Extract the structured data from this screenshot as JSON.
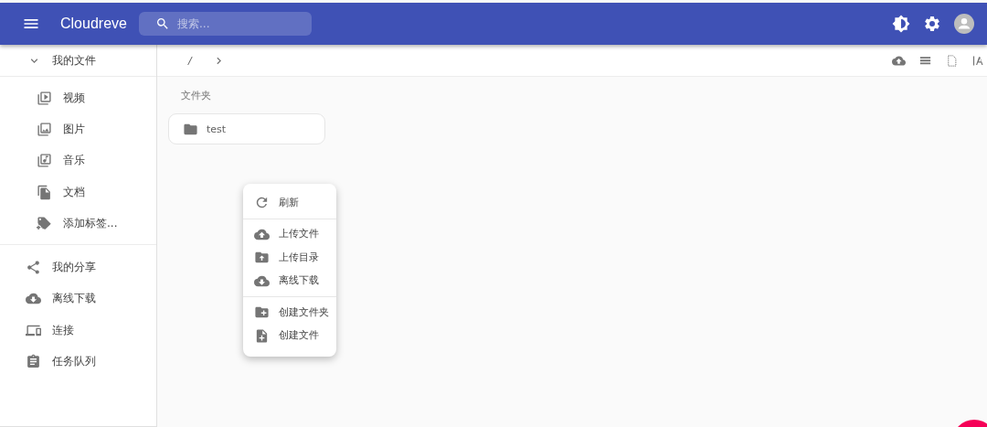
{
  "app_bar": {
    "title": "Cloudreve",
    "search": {
      "placeholder": "搜索..."
    }
  },
  "sidebar": {
    "group": {
      "label": "我的文件",
      "expanded": true,
      "children": [
        {
          "label": "视频"
        },
        {
          "label": "图片"
        },
        {
          "label": "音乐"
        },
        {
          "label": "文档"
        },
        {
          "label": "添加标签..."
        }
      ]
    },
    "items": [
      {
        "label": "我的分享"
      },
      {
        "label": "离线下载"
      },
      {
        "label": "连接"
      },
      {
        "label": "任务队列"
      }
    ]
  },
  "breadcrumb": {
    "root": "/"
  },
  "files": {
    "section_title": "文件夹",
    "folders": [
      {
        "name": "test"
      }
    ]
  },
  "context_menu": {
    "groups": [
      [
        {
          "label": "刷新"
        }
      ],
      [
        {
          "label": "上传文件"
        },
        {
          "label": "上传目录"
        },
        {
          "label": "离线下载"
        }
      ],
      [
        {
          "label": "创建文件夹"
        },
        {
          "label": "创建文件"
        }
      ]
    ]
  }
}
